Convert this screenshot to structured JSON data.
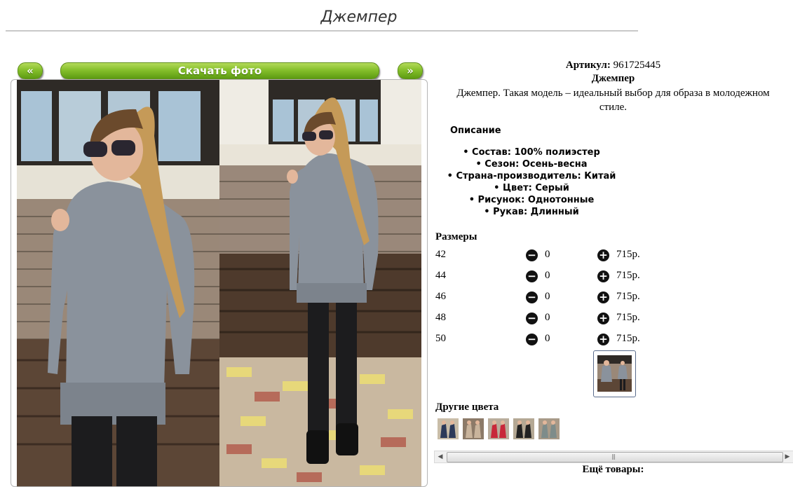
{
  "page": {
    "title": "Джемпер"
  },
  "photo_nav": {
    "prev_label": "«",
    "download_label": "Скачать фото",
    "next_label": "»"
  },
  "product": {
    "sku_label": "Артикул:",
    "sku_value": "961725445",
    "name": "Джемпер",
    "description": "Джемпер. Такая модель – идеальный выбор для образа в молодежном стиле.",
    "description_heading": "Описание",
    "attributes": [
      "Состав: 100% полиэстер",
      "Сезон: Осень-весна",
      "Страна-производитель: Китай",
      "Цвет: Серый",
      "Рисунок: Однотонные",
      "Рукав: Длинный"
    ]
  },
  "sizes": {
    "heading": "Размеры",
    "rows": [
      {
        "size": "42",
        "qty": "0",
        "price": "715р."
      },
      {
        "size": "44",
        "qty": "0",
        "price": "715р."
      },
      {
        "size": "46",
        "qty": "0",
        "price": "715р."
      },
      {
        "size": "48",
        "qty": "0",
        "price": "715р."
      },
      {
        "size": "50",
        "qty": "0",
        "price": "715р."
      }
    ],
    "minus_glyph": "−",
    "plus_glyph": "+"
  },
  "other_colors": {
    "heading": "Другие цвета",
    "swatches": [
      "#2c3a5a",
      "#c9b49c",
      "#c8283a",
      "#222222",
      "#7e8c8a"
    ]
  },
  "more_goods": {
    "label": "Ещё товары:"
  },
  "colors": {
    "button_green": "#86c02c",
    "sweater_grey": "#8a929c"
  }
}
